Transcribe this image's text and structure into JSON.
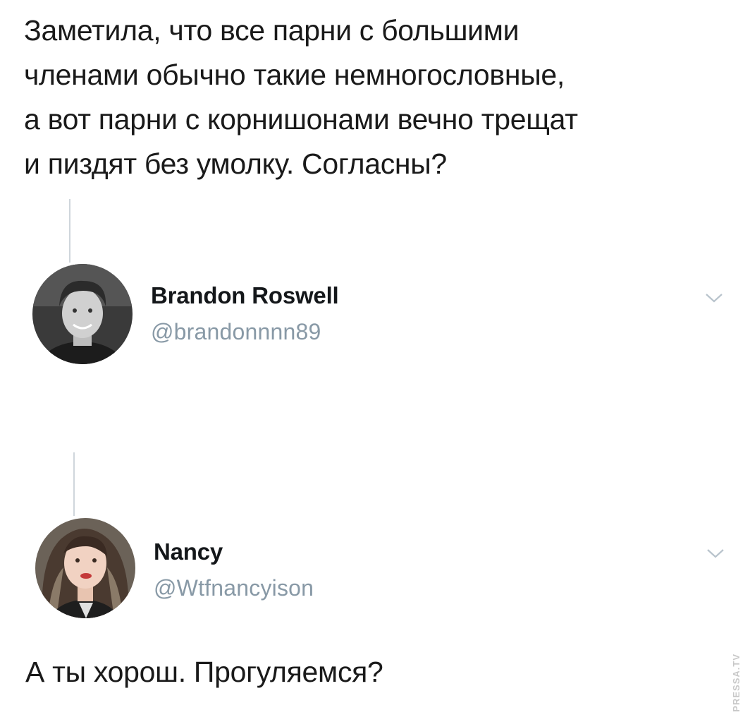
{
  "post": {
    "text": "Заметила, что все парни с большими\nчленами обычно такие немногословные,\nа вот парни с корнишонами вечно трещат\nи пиздят без умолку. Согласны?"
  },
  "replies": [
    {
      "display_name": "Brandon Roswell",
      "handle": "@brandonnnn89",
      "avatar_icon": "person-photo-grayscale",
      "menu_icon": "chevron-down-icon"
    },
    {
      "display_name": "Nancy",
      "handle": "@Wtfnancyison",
      "avatar_icon": "person-photo-color",
      "menu_icon": "chevron-down-icon"
    }
  ],
  "reply_text": "А ты хорош. Прогуляемся?",
  "watermark": "PRESSA.TV",
  "colors": {
    "text": "#1a1a1a",
    "handle": "#8899a6",
    "thread_line": "#cfd6dc",
    "chevron": "#b8c3cc"
  }
}
